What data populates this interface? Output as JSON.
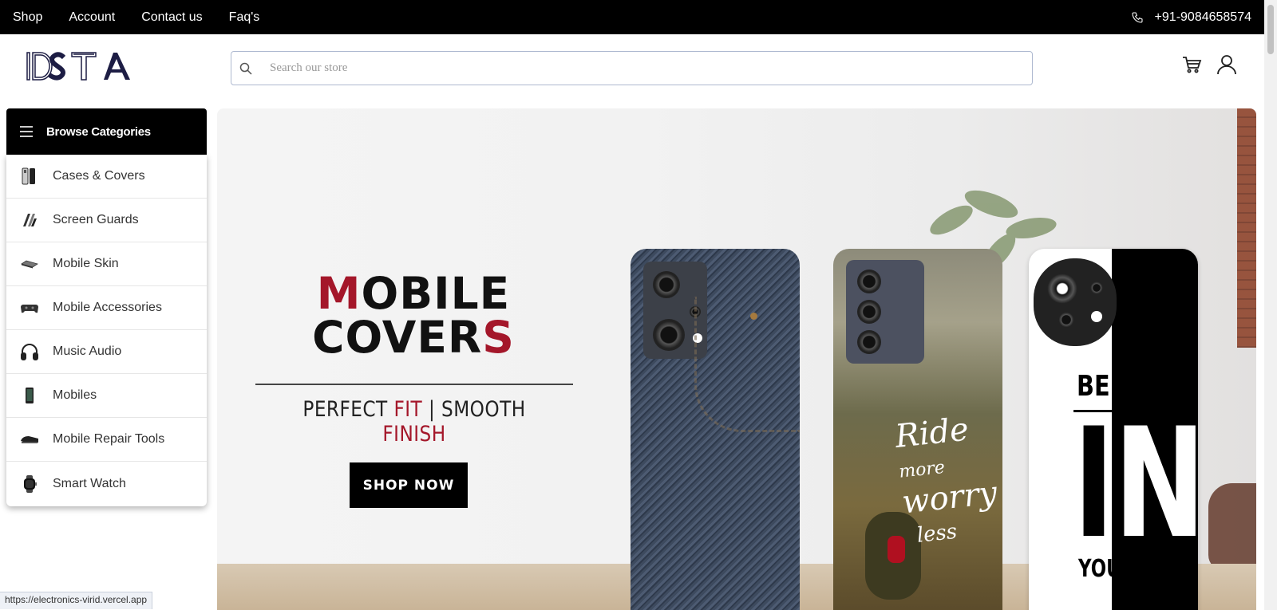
{
  "topbar": {
    "nav": [
      "Shop",
      "Account",
      "Contact us",
      "Faq's"
    ],
    "phone": "+91-9084658574"
  },
  "header": {
    "logo_text": "DSTA",
    "search_placeholder": "Search our store"
  },
  "categories": {
    "title": "Browse Categories",
    "items": [
      {
        "label": "Cases & Covers",
        "icon": "phone-case-icon"
      },
      {
        "label": "Screen Guards",
        "icon": "screen-guard-icon"
      },
      {
        "label": "Mobile Skin",
        "icon": "mobile-skin-icon"
      },
      {
        "label": "Mobile Accessories",
        "icon": "gamepad-icon"
      },
      {
        "label": "Music Audio",
        "icon": "headphones-icon"
      },
      {
        "label": "Mobiles",
        "icon": "smartphone-icon"
      },
      {
        "label": "Mobile Repair Tools",
        "icon": "repair-tool-icon"
      },
      {
        "label": "Smart Watch",
        "icon": "smartwatch-icon"
      }
    ]
  },
  "banner": {
    "title_line1_first": "M",
    "title_line1_rest": "OBILE",
    "title_line2_rest": "COVER",
    "title_line2_last": "S",
    "sub_perfect": "PERFECT",
    "sub_fit": "FIT",
    "sub_sep": "|",
    "sub_smooth": "SMOOTH",
    "sub_finish": "FINISH",
    "cta": "SHOP NOW",
    "case2_text": [
      "Ride",
      "more",
      "worry",
      "less"
    ],
    "case3_text": [
      "BELIEVE",
      "IN",
      "YOURSELF"
    ]
  },
  "status": {
    "url": "https://electronics-virid.vercel.app"
  },
  "colors": {
    "accent_red": "#a4172a",
    "topbar_bg": "#000000"
  }
}
